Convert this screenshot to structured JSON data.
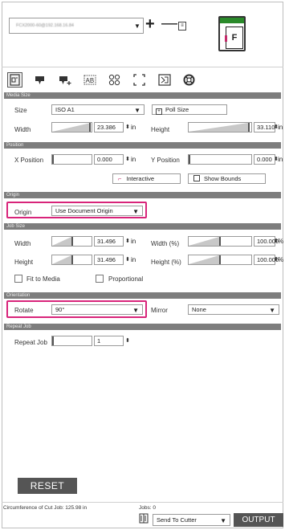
{
  "device": {
    "connection_text": "FCX2000-60@192.168.16.84",
    "add_label": "+",
    "remove_label": "—",
    "cutter_page_label": "F"
  },
  "tabs": [
    {
      "name": "media-tab",
      "icon": "document-icon"
    },
    {
      "name": "cut-tab",
      "icon": "cutter-icon"
    },
    {
      "name": "add-cutter-tab",
      "icon": "cutter-plus-icon"
    },
    {
      "name": "text-tab",
      "icon": "text-box-icon"
    },
    {
      "name": "marks-tab",
      "icon": "circles-icon"
    },
    {
      "name": "frame-tab",
      "icon": "corners-icon"
    },
    {
      "name": "registration-tab",
      "icon": "registration-icon"
    },
    {
      "name": "weed-tab",
      "icon": "lifebuoy-icon"
    }
  ],
  "media_size": {
    "header": "Media Size",
    "size_label": "Size",
    "size_value": "ISO A1",
    "poll_size_label": "Poll Size",
    "width_label": "Width",
    "width_value": "23.386",
    "width_unit": "in",
    "height_label": "Height",
    "height_value": "33.110",
    "height_unit": "in"
  },
  "position": {
    "header": "Position",
    "x_label": "X Position",
    "x_value": "0.000",
    "x_unit": "in",
    "y_label": "Y Position",
    "y_value": "0.000",
    "y_unit": "in",
    "interactive_label": "Interactive",
    "show_bounds_label": "Show Bounds"
  },
  "origin": {
    "header": "Origin",
    "label": "Origin",
    "value": "Use Document Origin"
  },
  "job_size": {
    "header": "Job Size",
    "width_label": "Width",
    "width_value": "31.496",
    "width_unit": "in",
    "width_pct_label": "Width (%)",
    "width_pct_value": "100.000",
    "width_pct_unit": "%",
    "height_label": "Height",
    "height_value": "31.496",
    "height_unit": "in",
    "height_pct_label": "Height (%)",
    "height_pct_value": "100.000",
    "height_pct_unit": "%",
    "fit_to_media_label": "Fit to Media",
    "proportional_label": "Proportional"
  },
  "orientation": {
    "header": "Orientation",
    "rotate_label": "Rotate",
    "rotate_value": "90°",
    "mirror_label": "Mirror",
    "mirror_value": "None"
  },
  "repeat_job": {
    "header": "Repeat Job",
    "label": "Repeat Job",
    "value": "1"
  },
  "reset_label": "RESET",
  "footer": {
    "circumference": "Circumference of Cut Job: 125.98 in",
    "jobs": "Jobs: 0",
    "destination": "Send To Cutter",
    "output_label": "OUTPUT"
  },
  "colors": {
    "section_header": "#7d7d7d",
    "highlight": "#d8247a",
    "button_dark": "#555555",
    "cutter_bar": "#2a8a2a"
  }
}
